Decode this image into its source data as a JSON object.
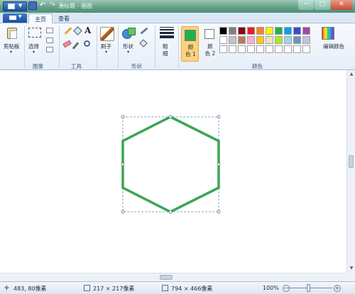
{
  "window": {
    "title": "无标题 - 画图",
    "controls": {
      "minimize": "─",
      "maximize": "□",
      "close": "✕"
    }
  },
  "ribbon": {
    "tabs": [
      {
        "label": "主页",
        "active": true
      },
      {
        "label": "查看",
        "active": false
      }
    ],
    "groups": {
      "clipboard": {
        "label": "剪贴板"
      },
      "image": {
        "label": "图像",
        "select_label": "选择"
      },
      "tools": {
        "label": "工具",
        "text_glyph": "A"
      },
      "brush": {
        "label": "刷子"
      },
      "shapes": {
        "label": "形状",
        "shapes_label": "形状"
      },
      "size": {
        "label": "粗细",
        "label_line1": "粗",
        "label_line2": "细"
      },
      "colors": {
        "label": "颜色",
        "color1_label_line1": "颜",
        "color1_label_line2": "色 1",
        "color2_label_line1": "颜",
        "color2_label_line2": "色 2",
        "color1_value": "#22b14c",
        "color2_value": "#ffffff",
        "edit_colors_label": "编辑颜色",
        "palette": [
          "#000000",
          "#7f7f7f",
          "#880015",
          "#ed1c24",
          "#ff7f27",
          "#fff200",
          "#22b14c",
          "#00a2e8",
          "#3f48cc",
          "#a349a4",
          "#ffffff",
          "#c3c3c3",
          "#b97a57",
          "#ffaec9",
          "#ffc90e",
          "#efe4b0",
          "#b5e61d",
          "#99d9ea",
          "#7092be",
          "#c8bfe7",
          "#ffffff",
          "#ffffff",
          "#ffffff",
          "#ffffff",
          "#ffffff",
          "#ffffff",
          "#ffffff",
          "#ffffff",
          "#ffffff",
          "#ffffff"
        ]
      }
    }
  },
  "canvas": {
    "shape": "hexagon",
    "stroke_color": "#3aa655"
  },
  "statusbar": {
    "cursor_position": "483, 80像素",
    "selection_size": "217 × 217像素",
    "image_size": "794 × 466像素",
    "zoom": "100%"
  }
}
